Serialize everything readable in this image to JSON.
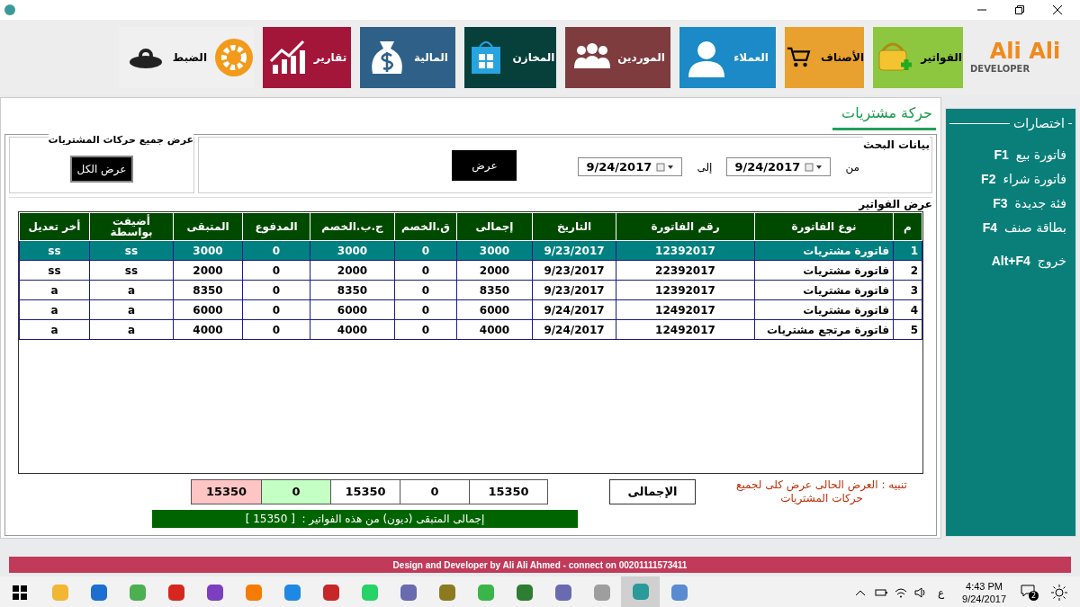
{
  "toolbar": {
    "tiles": [
      {
        "label": "الفواتير",
        "color": "#8dc63f"
      },
      {
        "label": "الأصناف",
        "color": "#e8a12e"
      },
      {
        "label": "العملاء",
        "color": "#1b8ac6"
      },
      {
        "label": "الموردين",
        "color": "#7e3c3f"
      },
      {
        "label": "المخازن",
        "color": "#073f3b"
      },
      {
        "label": "المالية",
        "color": "#2f6188"
      },
      {
        "label": "تقارير",
        "color": "#a3163a"
      },
      {
        "label": "الضبط",
        "color": "#f0f0f0"
      }
    ],
    "logo": {
      "name": "Ali Ali",
      "subtitle": "DEVELOPER"
    }
  },
  "page_title": "حركة مشتريات",
  "search": {
    "legend": "بيانات البحث",
    "from_label": "من",
    "from_date": "9/24/2017",
    "to_label": "إلى",
    "to_date": "9/24/2017",
    "button": "عرض"
  },
  "show_all": {
    "legend": "عرض جميع حركات المشتريات",
    "button": "عرض الكل"
  },
  "invoices": {
    "legend": "عرض الفواتير",
    "columns": [
      "م",
      "نوع الفاتورة",
      "رقم الفاتورة",
      "التاريخ",
      "إجمالى",
      "ق.الخصم",
      "ج.ب.الخصم",
      "المدفوع",
      "المتبقى",
      "أضيفت بواسطة",
      "أخر تعديل"
    ],
    "rows": [
      {
        "selected": true,
        "cells": [
          "1",
          "فاتورة مشتريات",
          "12392017",
          "9/23/2017",
          "3000",
          "0",
          "3000",
          "0",
          "3000",
          "ss",
          "ss"
        ]
      },
      {
        "selected": false,
        "cells": [
          "2",
          "فاتورة مشتريات",
          "22392017",
          "9/23/2017",
          "2000",
          "0",
          "2000",
          "0",
          "2000",
          "ss",
          "ss"
        ]
      },
      {
        "selected": false,
        "cells": [
          "3",
          "فاتورة مشتريات",
          "12392017",
          "9/23/2017",
          "8350",
          "0",
          "8350",
          "0",
          "8350",
          "a",
          "a"
        ]
      },
      {
        "selected": false,
        "cells": [
          "4",
          "فاتورة مشتريات",
          "12492017",
          "9/24/2017",
          "6000",
          "0",
          "6000",
          "0",
          "6000",
          "a",
          "a"
        ]
      },
      {
        "selected": false,
        "cells": [
          "5",
          "فاتورة مرتجع مشتريات",
          "12492017",
          "9/24/2017",
          "4000",
          "0",
          "4000",
          "0",
          "4000",
          "a",
          "a"
        ]
      }
    ]
  },
  "totals": {
    "note": "تنبيه : العرض الحالى عرض كلى لجميع حركات المشتريات",
    "button": "الإجمالى",
    "values": [
      {
        "value": "15350",
        "color": "#ffffff"
      },
      {
        "value": "0",
        "color": "#ffffff"
      },
      {
        "value": "15350",
        "color": "#ffffff"
      },
      {
        "value": "0",
        "color": "#c4ffc4"
      },
      {
        "value": "15350",
        "color": "#ffc4c4"
      }
    ],
    "summary": "إجمالى المتبقى (ديون) من هذه الفواتير :  [ 15350 ]"
  },
  "shortcuts": {
    "legend": "اختصارات",
    "items": [
      {
        "label": "فاتورة بيع",
        "key": "F1"
      },
      {
        "label": "فاتورة شراء",
        "key": "F2"
      },
      {
        "label": "فئة جديدة",
        "key": "F3"
      },
      {
        "label": "بطاقة صنف",
        "key": "F4"
      },
      {
        "label": "خروج",
        "key": "Alt+F4"
      }
    ]
  },
  "footer": "Design and Developer by Ali Ali Ahmed - connect on 00201111573411",
  "taskbar": {
    "apps": [
      {
        "selected": false
      },
      {
        "selected": false
      },
      {
        "selected": false
      },
      {
        "selected": false
      },
      {
        "selected": false
      },
      {
        "selected": false
      },
      {
        "selected": false
      },
      {
        "selected": false
      },
      {
        "selected": false
      },
      {
        "selected": false
      },
      {
        "selected": false
      },
      {
        "selected": false
      },
      {
        "selected": false
      },
      {
        "selected": false
      },
      {
        "selected": false
      },
      {
        "selected": true
      },
      {
        "selected": false
      }
    ],
    "language": "ع",
    "time": "4:43 PM",
    "date": "9/24/2017",
    "notifications": "2"
  }
}
